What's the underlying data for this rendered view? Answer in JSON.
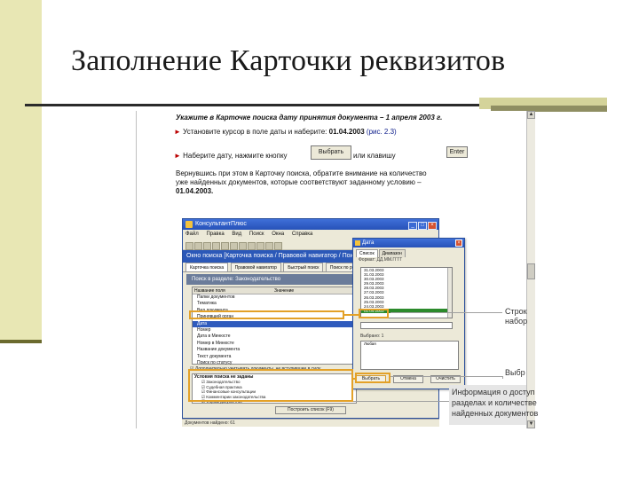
{
  "slide": {
    "title": "Заполнение Карточки реквизитов"
  },
  "instructions": {
    "line1": "Укажите в Карточке поиска дату принятия документа – 1 апреля 2003 г.",
    "line2_prefix": "Установите курсор в поле даты и наберите:",
    "line2_value": "01.04.2003",
    "line2_ref": "(рис. 2.3)",
    "line3_prefix": "Наберите дату, нажмите кнопку",
    "line3_button": "Выбрать",
    "line3_middle": "или клавишу",
    "line3_key": "Enter",
    "line4": "Вернувшись при этом в Карточку поиска, обратите внимание на количество",
    "line5": "уже найденных документов, которые соответствуют заданному условию –",
    "line6": "01.04.2003."
  },
  "app": {
    "title": "КонсультантПлюс",
    "menu": [
      "Файл",
      "Правка",
      "Вид",
      "Поиск",
      "Окна",
      "Справка"
    ],
    "doc_title": "Окно поиска [Карточка поиска / Правовой навигатор / Поиск по",
    "tabs": [
      "Карточка поиска",
      "Правовой навигатор",
      "Быстрый поиск",
      "Поиск по реквизитам"
    ],
    "search_header": "Поиск в разделе: Законодательство",
    "columns": [
      "Название поля",
      "Значение"
    ],
    "fields": [
      "Папки документов",
      "Тематика",
      "Вид документа",
      "Принявший орган",
      "Дата",
      "Номер",
      "Дата в Минюсте",
      "Номер в Минюсте",
      "Название документа",
      "Текст документа",
      "Поиск по статусу"
    ],
    "selected_field_index": 4,
    "checkbox_label": "Дополнительно учитывать документы, не вступившие в силу",
    "results_header": "Условия поиска не заданы",
    "results": [
      "Законодательство",
      "Судебная практика",
      "Финансовые консультации",
      "Комментарии законодательства",
      "Формы документов"
    ],
    "build_button": "Построить список (F9)",
    "status": "Документов найдено: 61"
  },
  "date_dialog": {
    "title": "Дата",
    "tabs": [
      "Список",
      "Диапазон"
    ],
    "format_label": "Формат: ДД.ММ.ГГГГ",
    "dates": [
      "31.03.2003",
      "31.03.2003",
      "30.03.2003",
      "29.03.2003",
      "28.03.2003",
      "27.03.2003",
      "26.03.2003",
      "25.03.2003",
      "24.03.2003",
      "01.04.2003"
    ],
    "selected_index": 9,
    "selected_label": "Выбрано: 1",
    "selected_items": [
      "Любая"
    ],
    "buttons": [
      "Выбрать",
      "Отмена",
      "Очистить"
    ]
  },
  "callouts": {
    "top": [
      "Строк",
      "набор"
    ],
    "middle": "Выбр",
    "bottom": [
      "Информация о доступ",
      "разделах и количестве",
      "найденных документов"
    ]
  },
  "icons": {
    "scroll_up": "▲",
    "scroll_down": "▼",
    "bullet": "►",
    "close": "×",
    "minimize": "_",
    "maximize": "□"
  }
}
